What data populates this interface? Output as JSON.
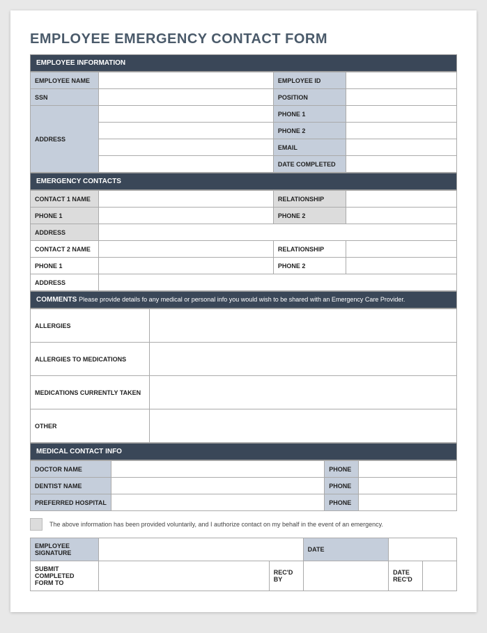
{
  "title": "EMPLOYEE EMERGENCY CONTACT FORM",
  "sections": {
    "employee_info": {
      "header": "EMPLOYEE INFORMATION",
      "labels": {
        "name": "EMPLOYEE NAME",
        "id": "EMPLOYEE ID",
        "ssn": "SSN",
        "position": "POSITION",
        "address": "ADDRESS",
        "phone1": "PHONE 1",
        "phone2": "PHONE 2",
        "email": "EMAIL",
        "date_completed": "DATE COMPLETED"
      }
    },
    "emergency_contacts": {
      "header": "EMERGENCY CONTACTS",
      "labels": {
        "contact1_name": "CONTACT 1 NAME",
        "contact2_name": "CONTACT 2 NAME",
        "relationship": "RELATIONSHIP",
        "phone1": "PHONE 1",
        "phone2": "PHONE 2",
        "address": "ADDRESS"
      }
    },
    "comments": {
      "header": "COMMENTS",
      "note": "Please provide details fo any medical or personal info you would wish to be shared with an Emergency Care Provider.",
      "labels": {
        "allergies": "ALLERGIES",
        "allergies_med": "ALLERGIES TO MEDICATIONS",
        "medications": "MEDICATIONS CURRENTLY TAKEN",
        "other": "OTHER"
      }
    },
    "medical": {
      "header": "MEDICAL CONTACT INFO",
      "labels": {
        "doctor": "DOCTOR NAME",
        "dentist": "DENTIST NAME",
        "hospital": "PREFERRED HOSPITAL",
        "phone": "PHONE"
      }
    },
    "auth": {
      "text": "The above information has been provided voluntarily, and I authorize contact on my behalf in the event of an emergency."
    },
    "signature": {
      "labels": {
        "signature": "EMPLOYEE SIGNATURE",
        "date": "DATE",
        "submit": "SUBMIT COMPLETED FORM TO",
        "recd_by": "REC'D BY",
        "date_recd": "DATE REC'D"
      }
    }
  }
}
